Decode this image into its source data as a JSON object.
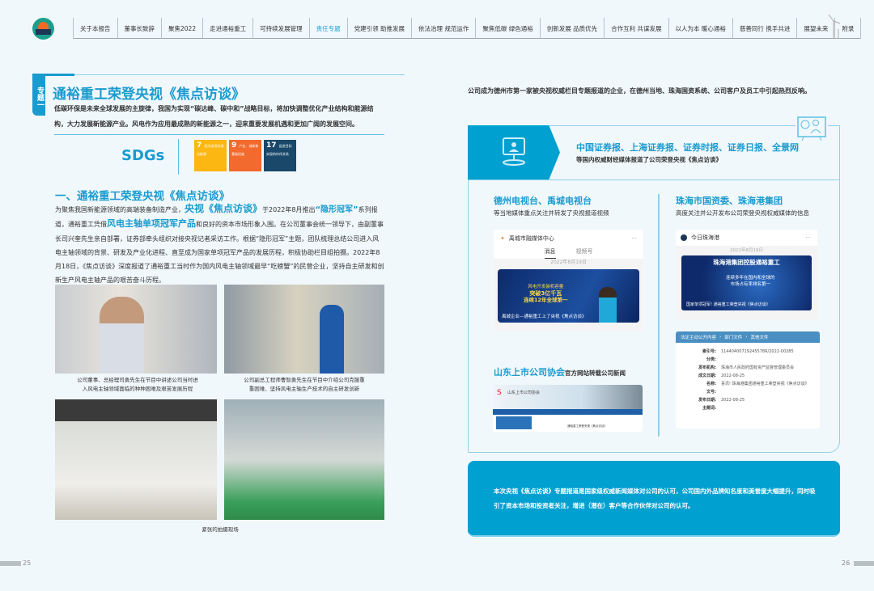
{
  "nav": {
    "items": [
      "关于本报告",
      "董事长致辞",
      "聚焦2022",
      "走进通裕重工",
      "可持续发展管理",
      "责任专题",
      "党建引领 助推发展",
      "依法治理 规范运作",
      "聚焦低碳 绿色通裕",
      "创新发展 品质优先",
      "合作互利 共谋发展",
      "以人为本 暖心通裕",
      "慈善同行 携手共进",
      "展望未来",
      "附录"
    ],
    "active_index": 5
  },
  "left": {
    "tab": "专题一",
    "title": "通裕重工荣登央视《焦点访谈》",
    "intro": "低碳环保是未来全球发展的主旋律，我国为实现“碳达峰、碳中和”战略目标，将加快调整优化产业结构和能源结构，大力发展新能源产业。风电作为应用最成熟的新能源之一，迎来重要发展机遇和更加广阔的发展空间。",
    "sdg_label": "SDGs",
    "sdgs": [
      {
        "num": "7",
        "text": "经济适用的清洁能源",
        "color": "#fcb713"
      },
      {
        "num": "9",
        "text": "产业、创新和基础设施",
        "color": "#f26a2d"
      },
      {
        "num": "17",
        "text": "促进目标实现的伙伴关系",
        "color": "#19486a"
      }
    ],
    "section_title": "一、通裕重工荣登央视《焦点访谈》",
    "body": {
      "p1": "为聚焦我国新能源领域的高端装备制造产业，",
      "hl1": "央视《焦点访谈》",
      "p2": "于2022年8月推出",
      "hl2": "“隐形冠军”",
      "p3": "系列报道，通裕重工凭借",
      "hl3": "风电主轴单项冠军产品",
      "p4": "和良好的资本市场形象入围。在公司董事会统一领导下，由副董事长司兴奎先生亲自部署，证券部牵头组织对接央视记者采访工作。根据“隐形冠军”主题，团队梳理总结公司进入风电主轴领域的背景、研发及产业化进程、直至成为国家单项冠军产品的发展历程，积极协助栏目组拍摄。2022年8月18日，《焦点访谈》深度报道了通裕重工当时作为国内风电主轴领域最早“吃螃蟹”的民营企业，坚持自主研发和创新生产风电主轴产品的艰苦奋斗历程。"
    },
    "captions": [
      "公司董事、总经理司勇先生在节目中讲述公司当时进入风电主轴领域面临的种种困难及艰苦发展历程",
      "公司副总工程师曹智勇先生在节目中介绍公司克服重重困难、坚持风电主轴生产技术的自主研发创新",
      "紧张的拍摄现场"
    ],
    "page": "25"
  },
  "right": {
    "intro": "公司成为德州市第一家被央视权威栏目专题报道的企业，在德州当地、珠海国资系统、公司客户及员工中引起热烈反响。",
    "banner": {
      "title": "中国证券报、上海证券报、证券时报、证券日报、全景网",
      "sub": "等国内权威财经媒体报道了公司荣登央视《焦点访谈》"
    },
    "dezhou": {
      "title": "德州电视台、禹城电视台",
      "sub": "等当地媒体重点关注并转发了央视报道视频",
      "app": "禹城市融媒体中心",
      "tabs": [
        "消息",
        "视频号"
      ],
      "date": "2022年8月19日",
      "video_lines": [
        "风电开发装机容量",
        "突破3亿千瓦",
        "连续12年全球第一"
      ],
      "video_caption": "禹城企业—通裕重工上了央视《焦点访谈》"
    },
    "zhuhai": {
      "title": "珠海市国资委、珠海港集团",
      "sub": "高度关注并公开发布公司荣登央视权威媒体的信息",
      "app": "今日珠海港",
      "date": "2022年8月19日",
      "img_title": "珠海港集团控股通裕重工",
      "img_lines": [
        "连续多年在国内和全球的",
        "市场占有率排名第一"
      ],
      "img_caption": "国家单项冠军! 通裕重工荣登央视《焦点访谈》",
      "breadcrumb": [
        "法定主动公开内容",
        "部门文件",
        "其他文件"
      ],
      "fields": [
        {
          "k": "索引号:",
          "v": "11440400719245578R/2022-00285"
        },
        {
          "k": "分类:",
          "v": ""
        },
        {
          "k": "发布机构:",
          "v": "珠海市人民政府国有资产监督管理委员会"
        },
        {
          "k": "成文日期:",
          "v": "2022-08-25"
        },
        {
          "k": "名称:",
          "v": "喜讯! 珠海港集团通裕重工荣登央视《焦点访谈》"
        },
        {
          "k": "文号:",
          "v": ""
        },
        {
          "k": "发布日期:",
          "v": "2022-08-25"
        },
        {
          "k": "主题词:",
          "v": ""
        }
      ]
    },
    "shandong": {
      "title": "山东上市公司协会",
      "title_rest": "官方网站转载公司新闻",
      "site": "山东上市公司协会",
      "article": "通裕重工荣登央视《焦点访谈》"
    },
    "summary": "本次央视《焦点访谈》专题报道是国家级权威新闻媒体对公司的认可，公司国内外品牌知名度和美誉度大幅提升，同时吸引了资本市场和投资者关注，增进（潜在）客户等合作伙伴对公司的认可。",
    "page": "26"
  },
  "colors": {
    "accent": "#1a9bd0",
    "panel": "#00a0d0"
  }
}
